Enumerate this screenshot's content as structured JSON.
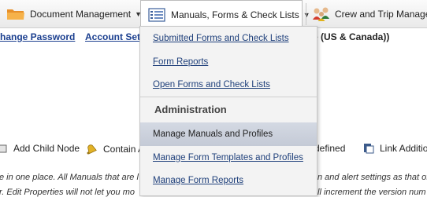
{
  "topnav": {
    "items": [
      {
        "label": "Document Management"
      },
      {
        "label": "Manuals, Forms & Check Lists"
      },
      {
        "label": "Crew and Trip Managen"
      }
    ]
  },
  "subnav": {
    "change_password": "hange Password",
    "account_settings": "Account Setti",
    "timezone_fragment": "e (US & Canada))"
  },
  "dropdown": {
    "items_top": [
      {
        "label": "Submitted Forms and Check Lists"
      },
      {
        "label": "Form Reports"
      },
      {
        "label": "Open Forms and Check Lists"
      }
    ],
    "heading": "Administration",
    "items_admin": [
      {
        "label": "Manage Manuals and Profiles"
      },
      {
        "label": "Manage Form Templates and Profiles"
      },
      {
        "label": "Manage Form Reports"
      }
    ]
  },
  "toolbar": {
    "add_child_node": "Add Child Node",
    "contain": "Contain A",
    "defined": "defined",
    "link_additional": "Link Additio"
  },
  "help_text": {
    "line1_left": "e in one place. All Manuals that are l",
    "line1_right": "n and alert settings as that of",
    "line2_left": "r. Edit Properties will not let you mo",
    "line2_right": "ll increment the version num"
  },
  "colors": {
    "link": "#1b3f8f",
    "menu_hover": "#c9ced9",
    "folder": "#f0a63a"
  }
}
